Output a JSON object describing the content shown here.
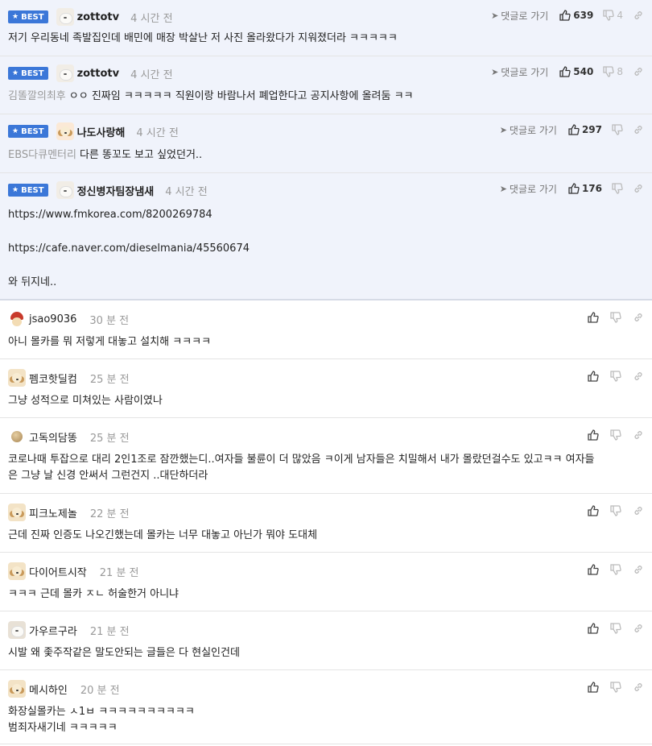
{
  "ui": {
    "best_label": "BEST",
    "reply_label": "댓글로 가기"
  },
  "best_comments": [
    {
      "nick": "zottotv",
      "time": "4 시간 전",
      "avatar": "cat",
      "up": "639",
      "down": "4",
      "prefix": "",
      "lines": [
        "저기 우리동네 족발집인데 배민에 매장 박살난 저 사진 올라왔다가 지워졌더라 ㅋㅋㅋㅋㅋ"
      ]
    },
    {
      "nick": "zottotv",
      "time": "4 시간 전",
      "avatar": "cat",
      "up": "540",
      "down": "8",
      "prefix": "김똘깔의최후",
      "lines": [
        "ㅇㅇ 진짜임 ㅋㅋㅋㅋㅋ 직원이랑 바람나서 폐업한다고 공지사항에 올려둠 ㅋㅋ"
      ]
    },
    {
      "nick": "나도사랑해",
      "time": "4 시간 전",
      "avatar": "dog-red",
      "up": "297",
      "down": "",
      "prefix": "EBS다큐멘터리",
      "lines": [
        "다른 똥꼬도 보고 싶었던거.."
      ]
    },
    {
      "nick": "정신병자팀장냄새",
      "time": "4 시간 전",
      "avatar": "cat",
      "up": "176",
      "down": "",
      "prefix": "",
      "lines": [
        "https://www.fmkorea.com/8200269784",
        "https://cafe.naver.com/dieselmania/45560674",
        "와 뒤지네.."
      ]
    }
  ],
  "comments": [
    {
      "nick": "jsao9036",
      "time": "30 분 전",
      "avatar": "red",
      "lines": [
        "아니 몰카를 뭐 저렇게 대놓고 설치해 ㅋㅋㅋㅋ"
      ]
    },
    {
      "nick": "펨코핫딜컴",
      "time": "25 분 전",
      "avatar": "dog",
      "lines": [
        "그냥 성적으로 미쳐있는 사람이였나"
      ]
    },
    {
      "nick": "고독의담똥",
      "time": "25 분 전",
      "avatar": "ball",
      "lines": [
        "코로나때 투잡으로 대리 2인1조로 잠깐했는디..여자들 불륜이 더 많았음 ㅋ이게 남자들은 치밀해서 내가 몰랐던걸수도 있고ㅋㅋ 여자들",
        "은 그냥 날 신경 안써서 그런건지 ..대단하더라"
      ]
    },
    {
      "nick": "피크노제놀",
      "time": "22 분 전",
      "avatar": "dog",
      "lines": [
        "근데 진짜 인증도 나오긴했는데 몰카는 너무 대놓고 아닌가 뭐야 도대체"
      ]
    },
    {
      "nick": "다이어트시작",
      "time": "21 분 전",
      "avatar": "dog",
      "lines": [
        "ㅋㅋㅋ 근데 몰카 ㅈㄴ 허술한거 아니냐"
      ]
    },
    {
      "nick": "가우르구라",
      "time": "21 분 전",
      "avatar": "cat-dark",
      "lines": [
        "시발 왜 좇주작같은 말도안되는 글들은 다 현실인건데"
      ]
    },
    {
      "nick": "메시하인",
      "time": "20 분 전",
      "avatar": "dog",
      "lines": [
        "화장실몰카는 ㅅ1ㅂ ㅋㅋㅋㅋㅋㅋㅋㅋㅋㅋ",
        "범죄자새기네 ㅋㅋㅋㅋㅋ"
      ]
    }
  ]
}
